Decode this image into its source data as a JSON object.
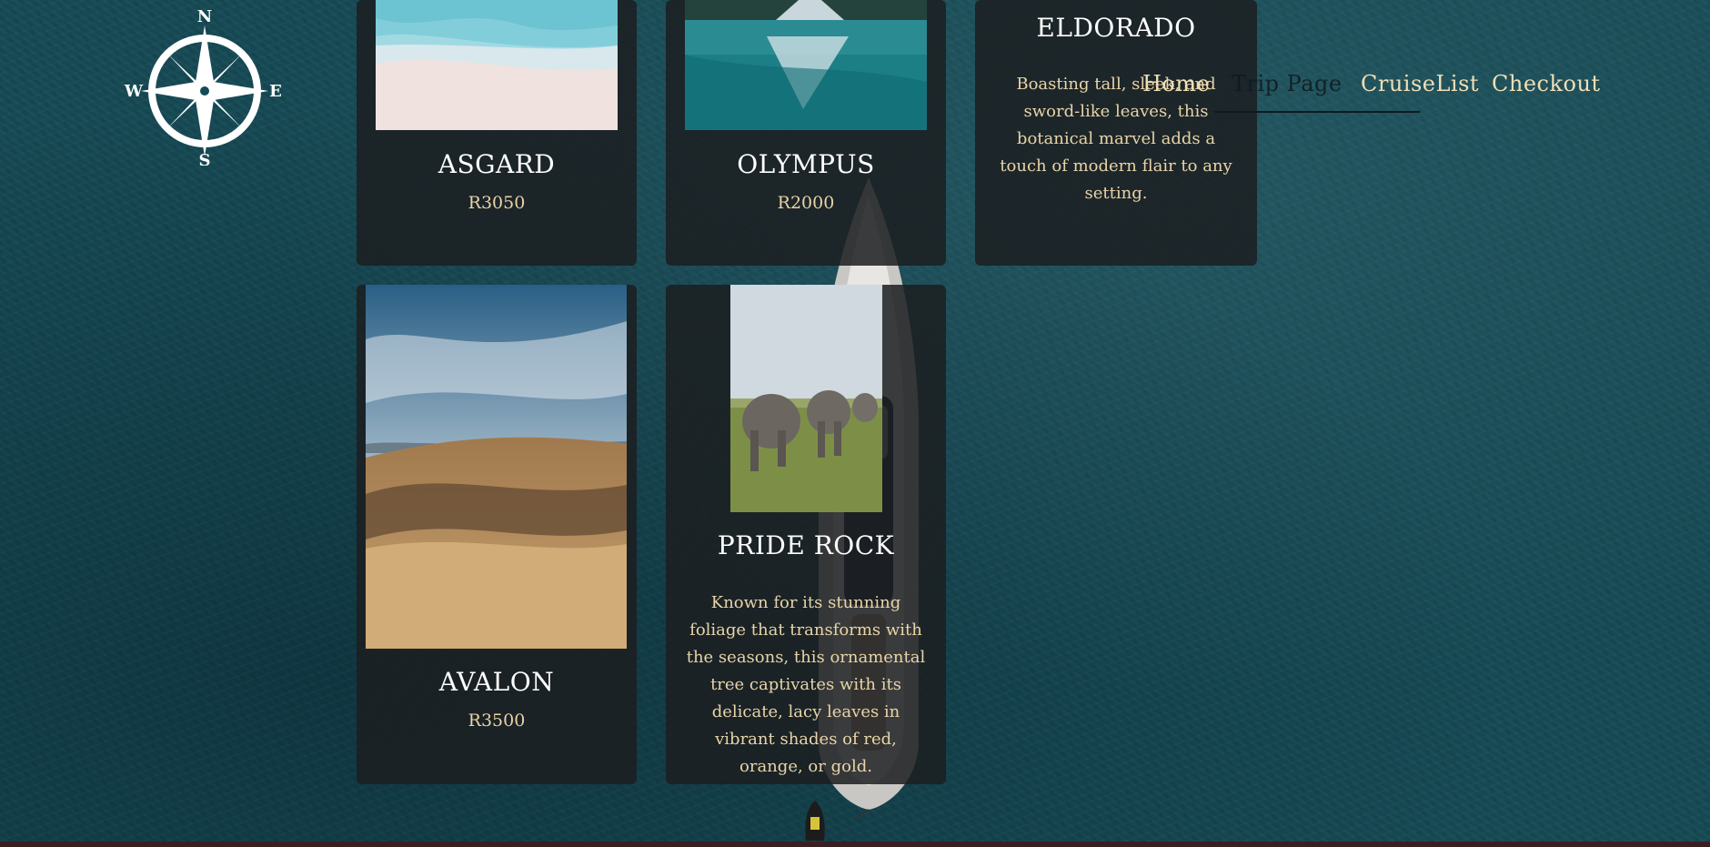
{
  "logo": {
    "directions": {
      "north": "N",
      "south": "S",
      "east": "E",
      "west": "W"
    }
  },
  "nav": {
    "home": "Home",
    "trip_page": "Trip Page",
    "cruise_list": "CruiseList",
    "checkout": "Checkout"
  },
  "cards": [
    {
      "title": "ASGARD",
      "price": "R3050"
    },
    {
      "title": "OLYMPUS",
      "price": "R2000"
    },
    {
      "title": "ELDORADO",
      "description": "Boasting tall, sleek, and sword-like leaves, this botanical marvel adds a touch of modern flair to any setting."
    },
    {
      "title": "AVALON",
      "price": "R3500"
    },
    {
      "title": "PRIDE ROCK",
      "description": "Known for its stunning foliage that transforms with the seasons, this ornamental tree captivates with its delicate, lacy leaves in vibrant shades of red, orange, or gold."
    }
  ],
  "colors": {
    "accent_text": "#e8d4a8",
    "card_bg": "#1c1e21",
    "ocean": "#164a55"
  }
}
